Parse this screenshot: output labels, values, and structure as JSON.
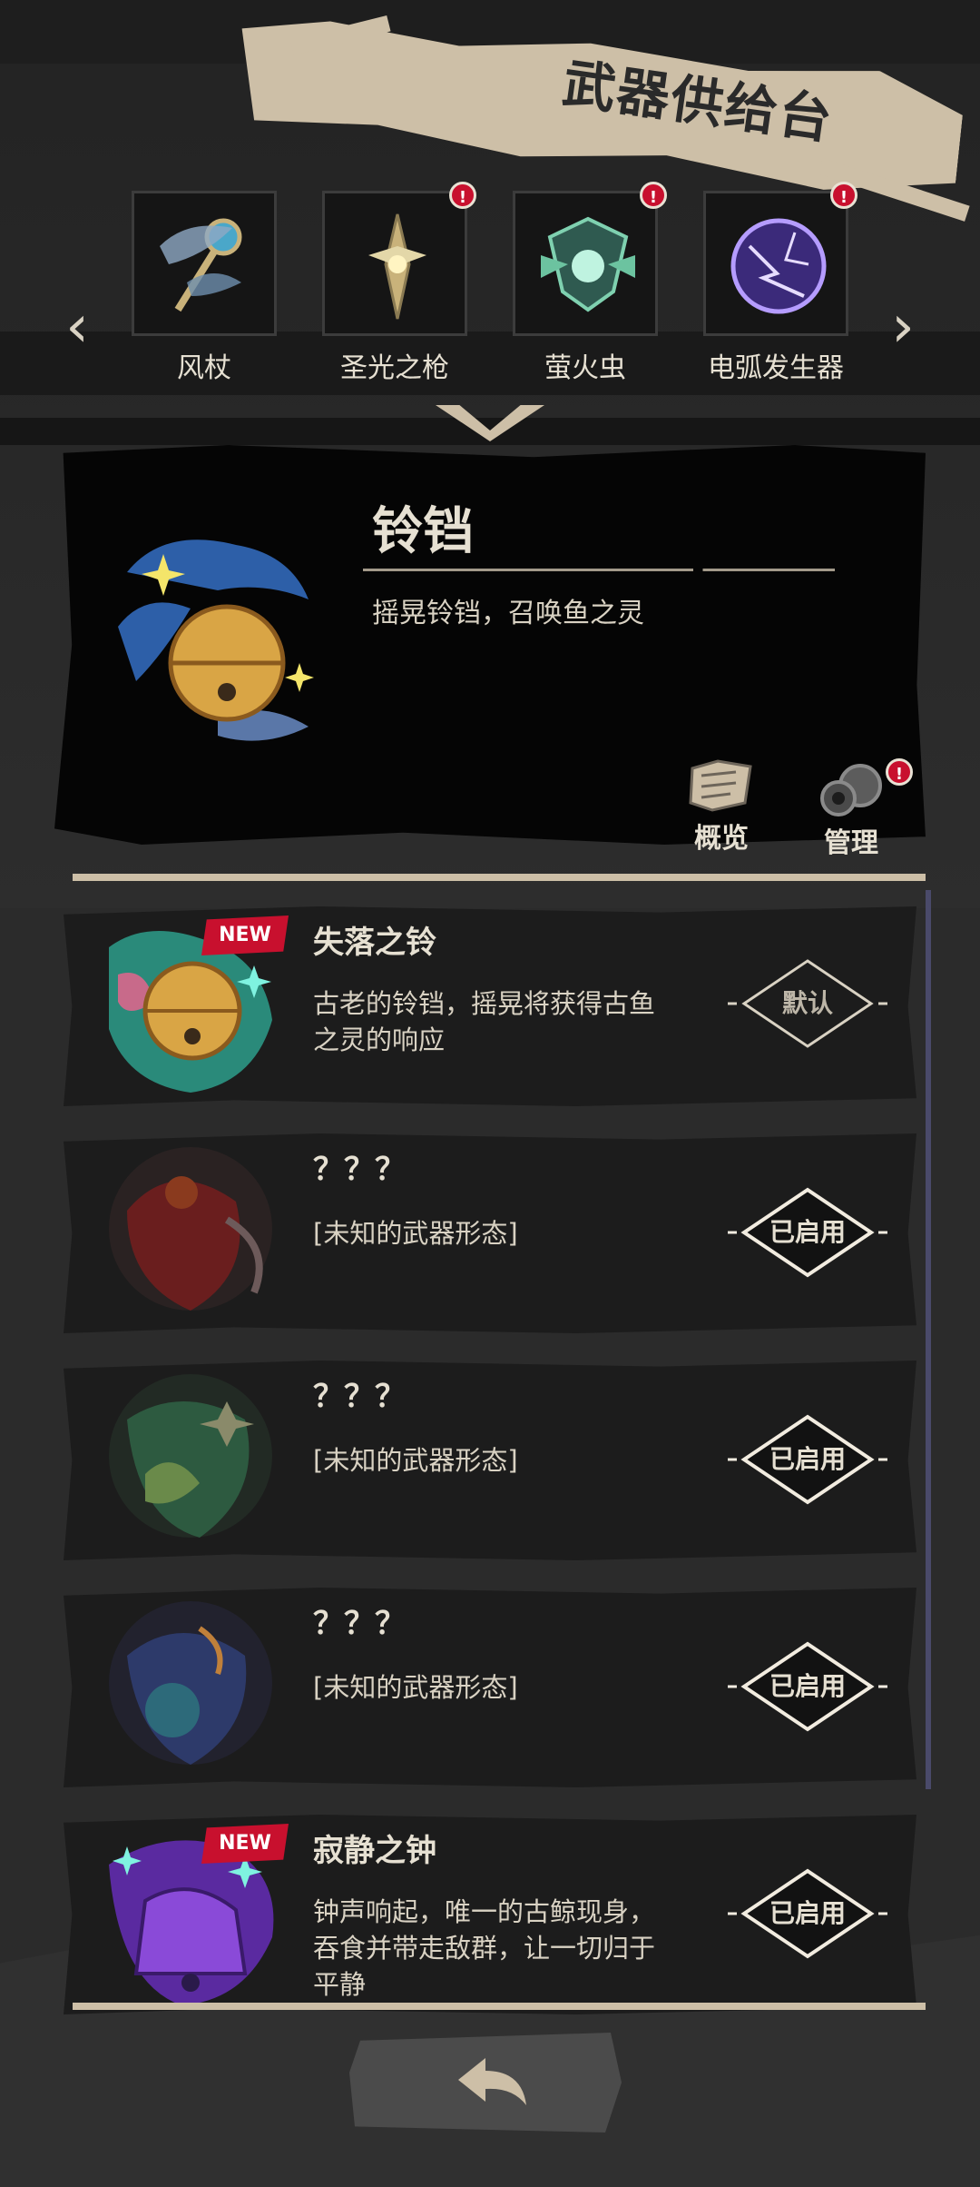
{
  "header": {
    "title": "武器供给台"
  },
  "weapons": [
    {
      "name": "风杖",
      "has_alert": false
    },
    {
      "name": "圣光之枪",
      "has_alert": true
    },
    {
      "name": "萤火虫",
      "has_alert": true
    },
    {
      "name": "电弧发生器",
      "has_alert": true
    }
  ],
  "nav": {
    "prev_glyph": "‹",
    "next_glyph": "›"
  },
  "alert_glyph": "!",
  "detail": {
    "name": "铃铛",
    "description": "摇晃铃铛，召唤鱼之灵",
    "overview_label": "概览",
    "manage_label": "管理",
    "manage_has_alert": true
  },
  "variants": [
    {
      "title": "失落之铃",
      "description": "古老的铃铛，摇晃将获得古鱼之灵的响应",
      "badge": "NEW",
      "button": "默认",
      "button_active": false
    },
    {
      "title": "？？？",
      "description": "[未知的武器形态]",
      "badge": "",
      "button": "已启用",
      "button_active": true
    },
    {
      "title": "？？？",
      "description": "[未知的武器形态]",
      "badge": "",
      "button": "已启用",
      "button_active": true
    },
    {
      "title": "？？？",
      "description": "[未知的武器形态]",
      "badge": "",
      "button": "已启用",
      "button_active": true
    },
    {
      "title": "寂静之钟",
      "description": "钟声响起，唯一的古鲸现身，吞食并带走敌群，让一切归于平静",
      "badge": "NEW",
      "button": "已启用",
      "button_active": true
    }
  ],
  "colors": {
    "accent": "#cdbfa7",
    "alert": "#c8102e",
    "panel": "#050505",
    "card": "#1c1c1c"
  }
}
